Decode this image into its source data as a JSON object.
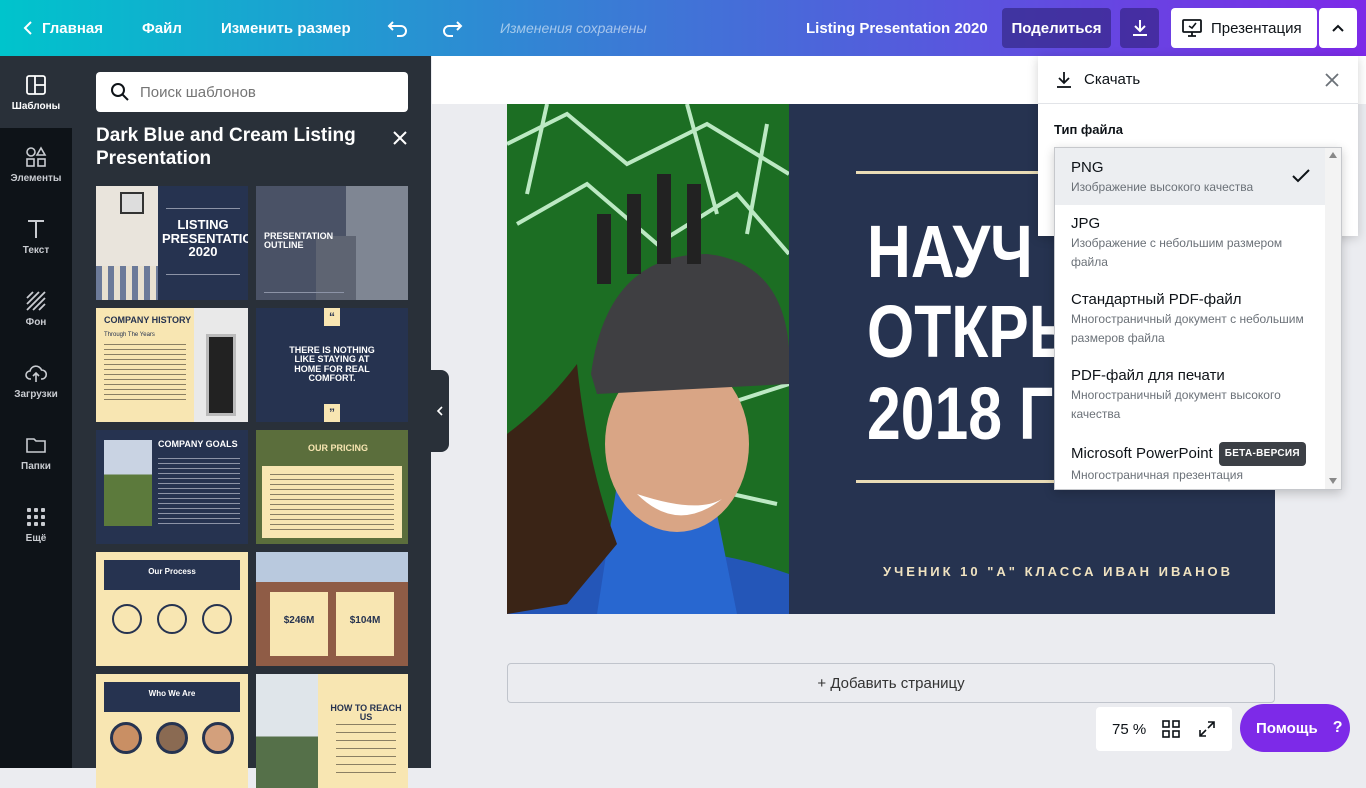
{
  "topbar": {
    "home_label": "Главная",
    "file_label": "Файл",
    "resize_label": "Изменить размер",
    "status": "Изменения сохранены",
    "doc_title": "Listing Presentation 2020",
    "share_label": "Поделиться",
    "present_label": "Презентация",
    "gradient_colors": [
      "#00c4cc",
      "#3a7bd5",
      "#7d2ae8"
    ]
  },
  "sidebar": {
    "items": [
      {
        "label": "Шаблоны",
        "icon": "templates-icon"
      },
      {
        "label": "Элементы",
        "icon": "elements-icon"
      },
      {
        "label": "Текст",
        "icon": "text-icon"
      },
      {
        "label": "Фон",
        "icon": "background-icon"
      },
      {
        "label": "Загрузки",
        "icon": "upload-cloud-icon"
      },
      {
        "label": "Папки",
        "icon": "folder-icon"
      },
      {
        "label": "Ещё",
        "icon": "more-grid-icon"
      }
    ]
  },
  "panel": {
    "search_placeholder": "Поиск шаблонов",
    "title": "Dark Blue and Cream Listing Presentation",
    "thumbs": {
      "t1_title": "LISTING PRESENTATION 2020",
      "t2_title": "PRESENTATION OUTLINE",
      "t3_title": "COMPANY HISTORY",
      "t3_sub": "Through The Years",
      "t4_title": "THERE IS NOTHING LIKE STAYING AT HOME FOR REAL COMFORT.",
      "t5_title": "COMPANY GOALS",
      "t6_title": "OUR PRICING",
      "t7_title": "Our Process",
      "t8_price1": "$246M",
      "t8_price2": "$104M",
      "t9_title": "Who We Are",
      "t10_title": "HOW TO REACH US"
    }
  },
  "slide": {
    "heading_line1": "НАУЧ",
    "heading_line2": "ОТКРЫ",
    "heading_line3": "2018 Г",
    "author": "УЧЕНИК 10 \"А\" КЛАССА ИВАН ИВАНОВ",
    "bg_color": "#263350",
    "accent_color": "#e9dcb6"
  },
  "canvas": {
    "add_page_label": "+ Добавить страницу",
    "zoom": "75 %",
    "help_label": "Помощь",
    "help_symbol": "?"
  },
  "download_panel": {
    "title": "Скачать",
    "file_type_label": "Тип файла",
    "options": [
      {
        "title": "PNG",
        "desc": "Изображение высокого качества",
        "selected": true
      },
      {
        "title": "JPG",
        "desc": "Изображение с небольшим размером файла"
      },
      {
        "title": "Стандартный PDF-файл",
        "desc": "Многостраничный документ с небольшим размеров файла"
      },
      {
        "title": "PDF-файл для печати",
        "desc": "Многостраничный документ высокого качества"
      },
      {
        "title": "Microsoft PowerPoint",
        "badge": "БЕТА-ВЕРСИЯ",
        "desc": "Многостраничная презентация"
      }
    ]
  }
}
